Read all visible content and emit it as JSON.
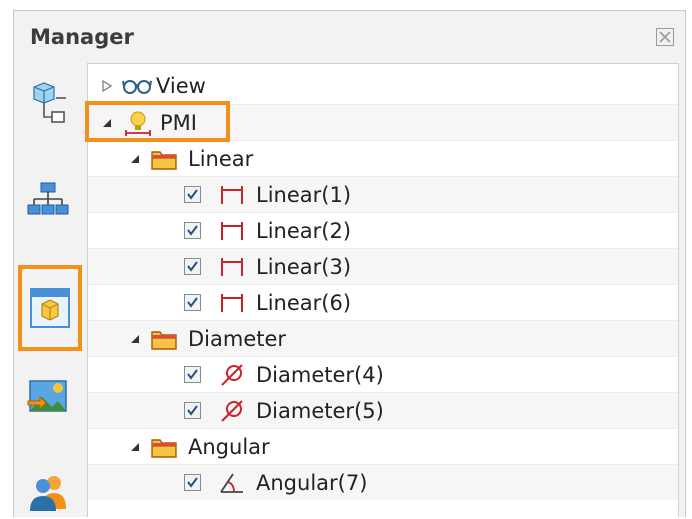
{
  "panel": {
    "title": "Manager",
    "close_icon": "close-x-icon"
  },
  "sidebar": {
    "buttons": [
      {
        "icon": "structure-node-icon"
      },
      {
        "icon": "hierarchy-tree-icon"
      },
      {
        "icon": "pmi-view-icon",
        "active": true
      },
      {
        "icon": "scene-image-icon"
      },
      {
        "icon": "users-icon"
      }
    ]
  },
  "tree": {
    "view": {
      "label": "View",
      "icon": "glasses-icon",
      "expanded": false
    },
    "pmi": {
      "label": "PMI",
      "icon": "bulb-dimension-icon",
      "expanded": true
    },
    "linear_folder": {
      "label": "Linear",
      "icon": "folder-icon",
      "expanded": true
    },
    "linear_items": [
      {
        "label": "Linear(1)",
        "checked": true
      },
      {
        "label": "Linear(2)",
        "checked": true
      },
      {
        "label": "Linear(3)",
        "checked": true
      },
      {
        "label": "Linear(6)",
        "checked": true
      }
    ],
    "diameter_folder": {
      "label": "Diameter",
      "icon": "folder-icon",
      "expanded": true
    },
    "diameter_items": [
      {
        "label": "Diameter(4)",
        "checked": true
      },
      {
        "label": "Diameter(5)",
        "checked": true
      }
    ],
    "angular_folder": {
      "label": "Angular",
      "icon": "folder-icon",
      "expanded": true
    },
    "angular_items": [
      {
        "label": "Angular(7)",
        "checked": true
      }
    ]
  },
  "colors": {
    "highlight": "#f39019",
    "dimension_red": "#c8232c",
    "folder_orange": "#f2a00c"
  }
}
